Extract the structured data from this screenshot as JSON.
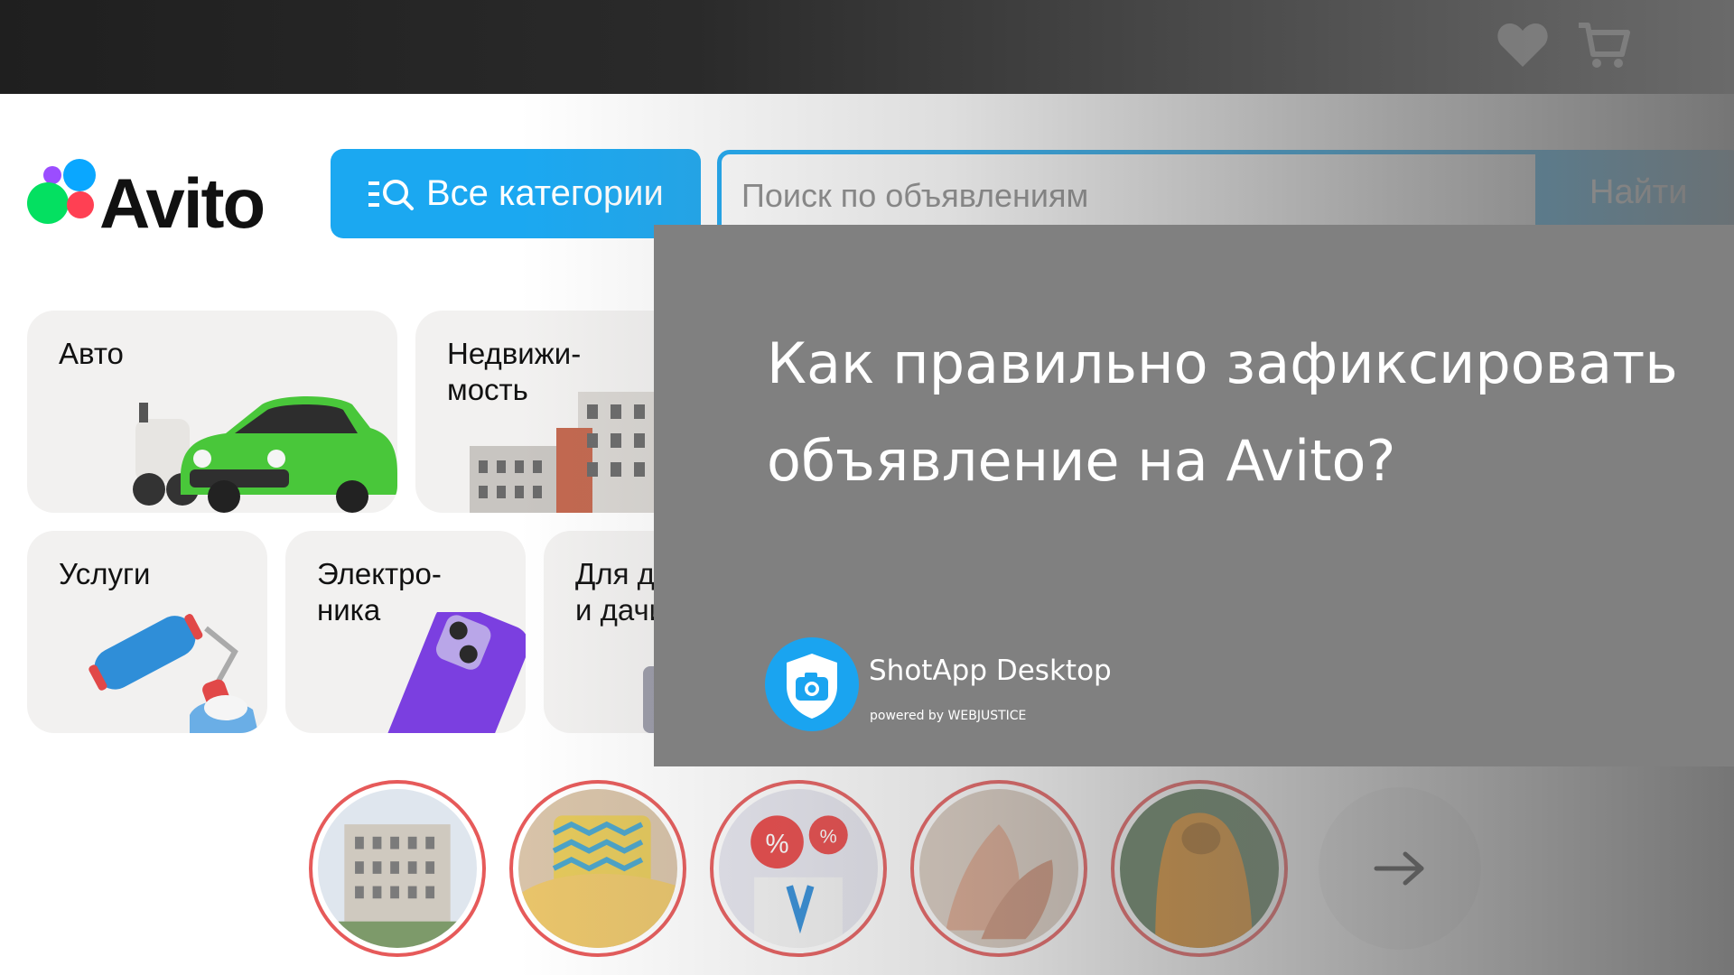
{
  "header": {
    "favorites_icon": "heart-icon",
    "cart_icon": "cart-icon"
  },
  "logo": {
    "text": "Avito"
  },
  "categories_button": {
    "label": "Все категории",
    "icon": "list-search-icon"
  },
  "search": {
    "placeholder": "Поиск по объявлениям",
    "button_label": "Найти"
  },
  "tiles": [
    {
      "label": "Авто"
    },
    {
      "label": "Недвижи-\nмость"
    },
    {
      "label": "Услуги"
    },
    {
      "label": "Электро-\nника"
    },
    {
      "label": "Для дома\nи дачи"
    }
  ],
  "stories": [
    {
      "topic": "building"
    },
    {
      "topic": "cushions"
    },
    {
      "topic": "discounts"
    },
    {
      "topic": "hands"
    },
    {
      "topic": "raincoat"
    }
  ],
  "stories_next_icon": "arrow-right-icon",
  "overlay": {
    "headline": "Как правильно зафиксировать\nобъявление на Avito?",
    "brand_name": "ShotApp Desktop",
    "brand_powered": "powered  by WEBJUSTICE",
    "colors": {
      "panel": "#808080",
      "text": "#ffffff",
      "badge": "#1aa4f0"
    }
  },
  "colors": {
    "accent": "#1ba8f1",
    "story_ring": "#e65a5a",
    "tile_bg": "#f2f1f0"
  }
}
